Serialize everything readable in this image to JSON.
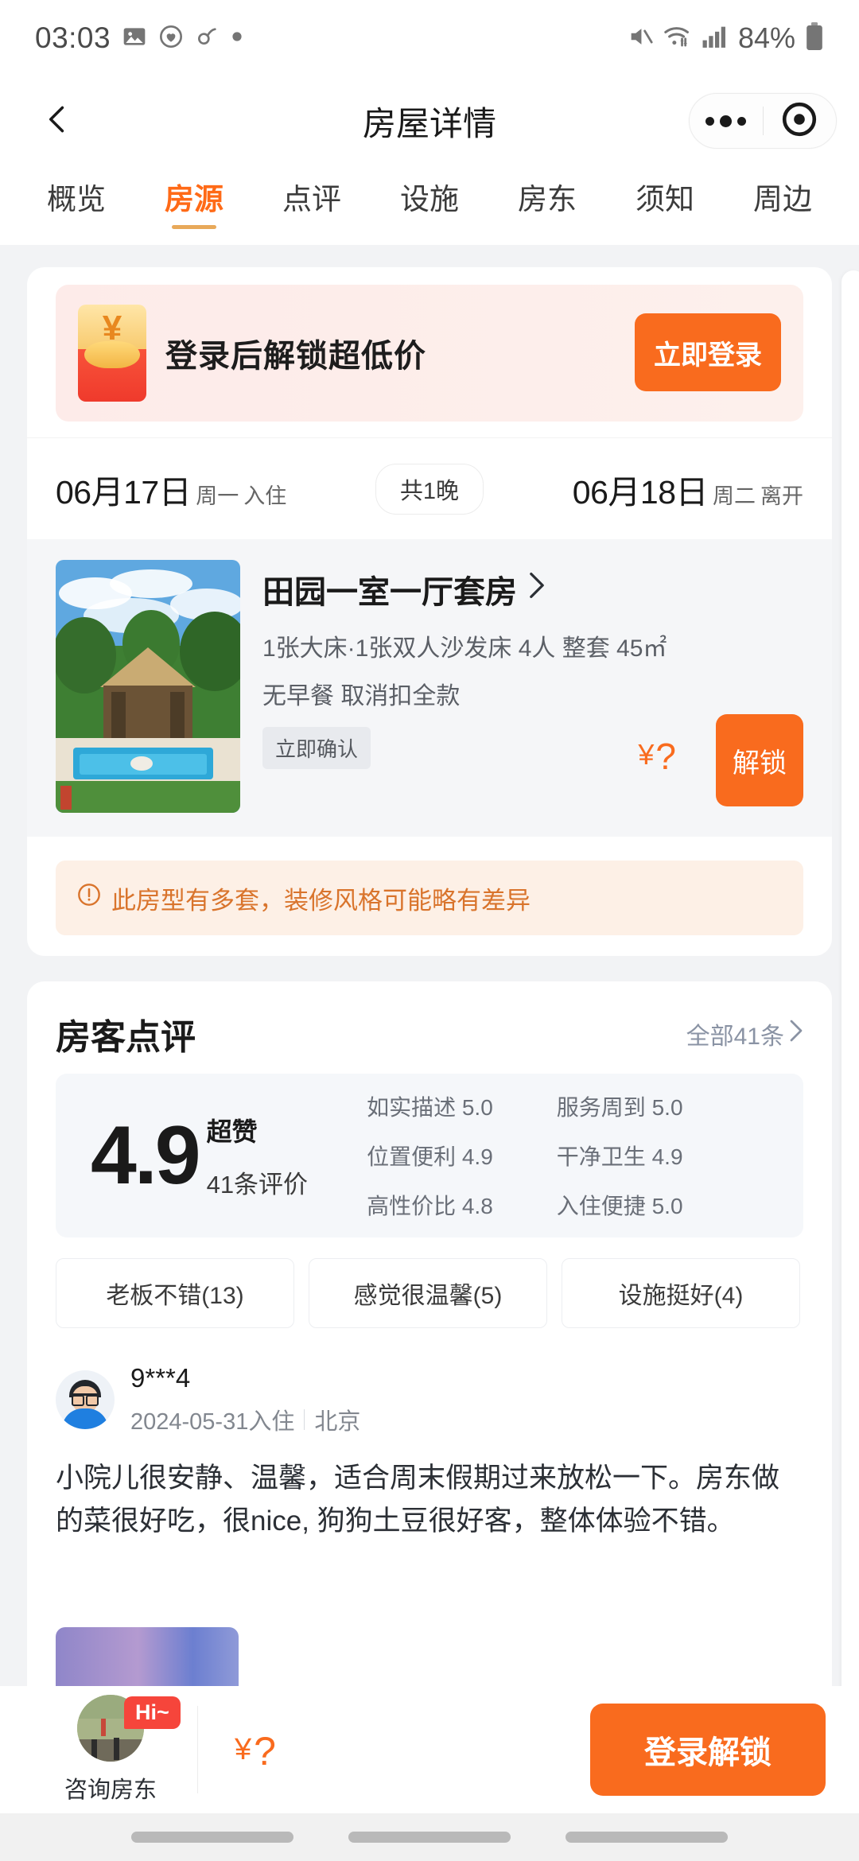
{
  "status_bar": {
    "time": "03:03",
    "battery_percent": "84%",
    "icons": [
      "gallery-icon",
      "heart-circle-icon",
      "link-icon",
      "dot-icon",
      "mute-icon",
      "wifi-icon",
      "signal-icon",
      "battery-icon"
    ]
  },
  "nav": {
    "title": "房屋详情",
    "back_icon": "chevron-left-icon",
    "capsule_more_icon": "more-dots-icon",
    "capsule_target_icon": "target-circle-icon"
  },
  "tabs": [
    {
      "label": "概览",
      "active": false
    },
    {
      "label": "房源",
      "active": true
    },
    {
      "label": "点评",
      "active": false
    },
    {
      "label": "设施",
      "active": false
    },
    {
      "label": "房东",
      "active": false
    },
    {
      "label": "须知",
      "active": false
    },
    {
      "label": "周边",
      "active": false
    }
  ],
  "promo": {
    "icon": "red-packet-icon",
    "text": "登录后解锁超低价",
    "button_label": "立即登录"
  },
  "dates": {
    "checkin_date": "06月17日",
    "checkin_weekday": "周一",
    "checkin_label": "入住",
    "nights": "共1晚",
    "checkout_date": "06月18日",
    "checkout_weekday": "周二",
    "checkout_label": "离开"
  },
  "room": {
    "title": "田园一室一厅套房",
    "title_chevron": "chevron-right-icon",
    "meta_beds": "1张大床·1张双人沙发床 4人 整套 45㎡",
    "meta_policy": "无早餐 取消扣全款",
    "confirm_tag": "立即确认",
    "price_currency": "¥",
    "price_value": "?",
    "unlock_label": "解锁",
    "thumbnail_name": "room-photo-pool"
  },
  "warning": {
    "icon": "exclamation-circle-icon",
    "text": "此房型有多套，装修风格可能略有差异"
  },
  "reviews": {
    "title": "房客点评",
    "all_link": "全部41条",
    "all_link_chevron": "chevron-right-icon",
    "score": "4.9",
    "score_label": "超赞",
    "score_count": "41条评价",
    "subratings": [
      {
        "name": "如实描述",
        "value": "5.0"
      },
      {
        "name": "位置便利",
        "value": "4.9"
      },
      {
        "name": "高性价比",
        "value": "4.8"
      },
      {
        "name": "服务周到",
        "value": "5.0"
      },
      {
        "name": "干净卫生",
        "value": "4.9"
      },
      {
        "name": "入住便捷",
        "value": "5.0"
      }
    ],
    "tags": [
      "老板不错(13)",
      "感觉很温馨(5)",
      "设施挺好(4)"
    ],
    "item": {
      "avatar_name": "user-avatar-glasses-man",
      "nickname": "9***4",
      "stay_date": "2024-05-31入住",
      "city": "北京",
      "text": "小院儿很安静、温馨，适合周末假期过来放松一下。房东做的菜很好吃，很nice, 狗狗土豆很好客，整体体验不错。",
      "photo_name": "review-photo-sky"
    }
  },
  "bottom_bar": {
    "consult_label": "咨询房东",
    "consult_badge": "Hi~",
    "consult_avatar_name": "host-avatar-outdoor",
    "price_currency": "¥",
    "price_value": "?",
    "cta_label": "登录解锁"
  },
  "colors": {
    "accent_orange": "#f96b1e",
    "tab_active": "#ff6a17",
    "warning_text": "#d9742c",
    "badge_red": "#f6453b"
  }
}
